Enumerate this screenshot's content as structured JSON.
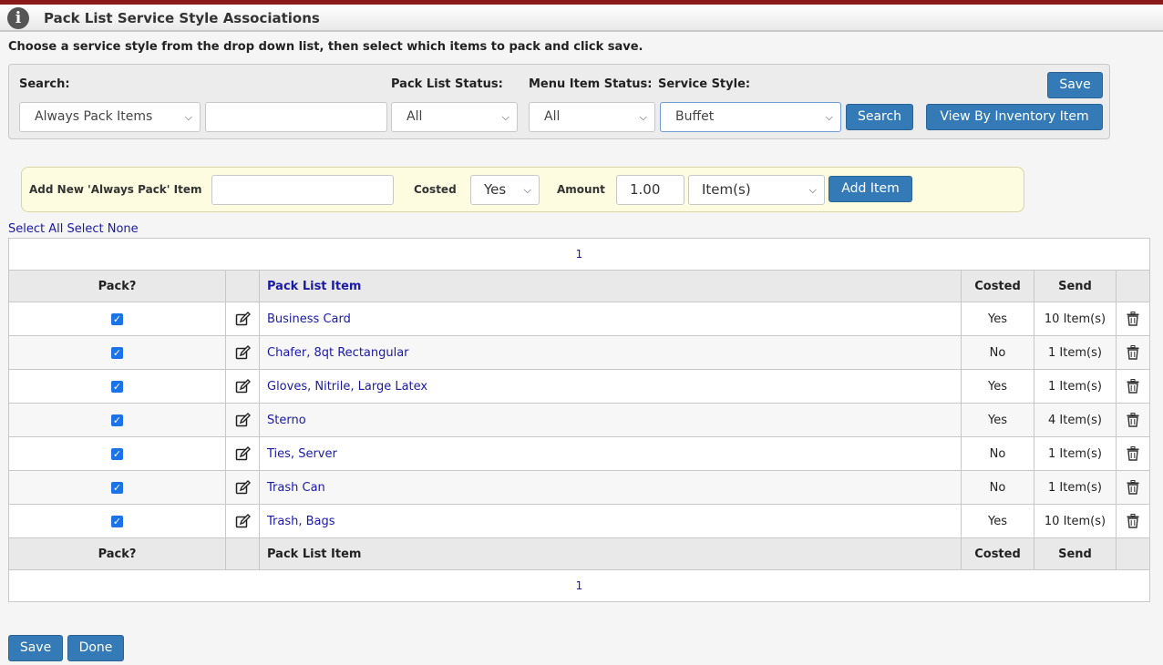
{
  "header": {
    "title": "Pack List Service Style Associations",
    "info_icon": "info-icon"
  },
  "instructions": "Choose a service style from the drop down list, then select which items to pack and click save.",
  "search": {
    "search_label": "Search:",
    "search_type_value": "Always Pack Items",
    "search_text_value": "",
    "pack_status_label": "Pack List Status:",
    "pack_status_value": "All",
    "menu_status_label": "Menu Item Status:",
    "menu_status_value": "All",
    "service_style_label": "Service Style:",
    "service_style_value": "Buffet",
    "search_button": "Search",
    "view_inventory_button": "View By Inventory Item",
    "save_button": "Save"
  },
  "add_item": {
    "label": "Add New 'Always Pack' Item",
    "name_value": "",
    "costed_label": "Costed",
    "costed_value": "Yes",
    "amount_label": "Amount",
    "amount_value": "1.00",
    "unit_value": "Item(s)",
    "add_button": "Add Item"
  },
  "select_links": {
    "select_all": "Select All",
    "select_none": "Select None"
  },
  "table": {
    "pager_top": "1",
    "pager_bottom": "1",
    "headers": {
      "pack": "Pack?",
      "item": "Pack List Item",
      "costed": "Costed",
      "send": "Send"
    },
    "rows": [
      {
        "item": "Business Card",
        "costed": "Yes",
        "send": "10 Item(s)",
        "pack": true
      },
      {
        "item": "Chafer, 8qt Rectangular",
        "costed": "No",
        "send": "1 Item(s)",
        "pack": true
      },
      {
        "item": "Gloves, Nitrile, Large Latex",
        "costed": "Yes",
        "send": "1 Item(s)",
        "pack": true
      },
      {
        "item": "Sterno",
        "costed": "Yes",
        "send": "4 Item(s)",
        "pack": true
      },
      {
        "item": "Ties, Server",
        "costed": "No",
        "send": "1 Item(s)",
        "pack": true
      },
      {
        "item": "Trash Can",
        "costed": "No",
        "send": "1 Item(s)",
        "pack": true
      },
      {
        "item": "Trash, Bags",
        "costed": "Yes",
        "send": "10 Item(s)",
        "pack": true
      }
    ]
  },
  "footer": {
    "save_button": "Save",
    "done_button": "Done"
  },
  "colors": {
    "accent": "#337ab7",
    "topbar": "#8b1a1a",
    "link": "#1a1aa6",
    "checkbox": "#1a73e8"
  }
}
